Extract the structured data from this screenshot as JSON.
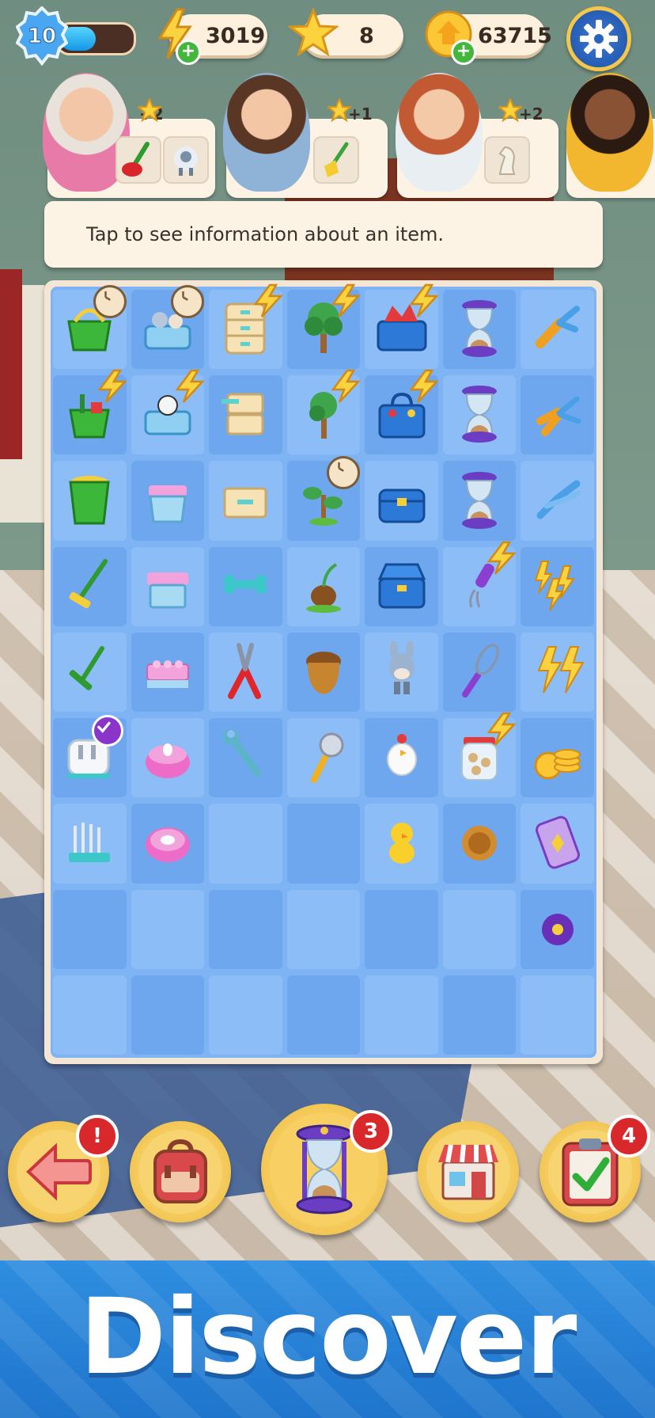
{
  "hud": {
    "level": "10",
    "xp_progress_fraction": 0.5,
    "energy": "3019",
    "stars": "8",
    "coins": "63715",
    "energy_icon": "lightning-bolt-icon",
    "star_icon": "star-icon",
    "coin_icon": "coin-icon",
    "settings_icon": "gear-icon"
  },
  "characters": [
    {
      "name_icon": "grandma-avatar",
      "reward": "+2",
      "items": [
        "plunger-icon",
        "sheep-toy-icon"
      ]
    },
    {
      "name_icon": "woman-overalls-avatar",
      "reward": "+1",
      "items": [
        "broom-icon"
      ]
    },
    {
      "name_icon": "redhead-woman-avatar",
      "reward": "+2",
      "items": [
        "chess-knight-icon"
      ]
    },
    {
      "name_icon": "woman-yellow-shirt-avatar",
      "reward": "",
      "items": []
    }
  ],
  "info_text": "Tap to see information about an item.",
  "board": {
    "columns": 7,
    "rows": 9,
    "items": [
      {
        "row": 0,
        "col": 0,
        "icon": "basket-icon",
        "badge": "clock"
      },
      {
        "row": 0,
        "col": 1,
        "icon": "toy-box-animals-icon",
        "badge": "clock"
      },
      {
        "row": 0,
        "col": 2,
        "icon": "drawer-cabinet-icon",
        "badge": "bolt"
      },
      {
        "row": 0,
        "col": 3,
        "icon": "tree-icon",
        "badge": "bolt"
      },
      {
        "row": 0,
        "col": 4,
        "icon": "toolbox-open-icon",
        "badge": "bolt"
      },
      {
        "row": 0,
        "col": 5,
        "icon": "hourglass-icon",
        "badge": ""
      },
      {
        "row": 0,
        "col": 6,
        "icon": "pliers-icon",
        "badge": ""
      },
      {
        "row": 1,
        "col": 0,
        "icon": "cleaning-bucket-icon",
        "badge": "bolt"
      },
      {
        "row": 1,
        "col": 1,
        "icon": "toy-box-cow-icon",
        "badge": "bolt"
      },
      {
        "row": 1,
        "col": 2,
        "icon": "drawers-icon",
        "badge": ""
      },
      {
        "row": 1,
        "col": 3,
        "icon": "young-tree-icon",
        "badge": "bolt"
      },
      {
        "row": 1,
        "col": 4,
        "icon": "toolbox-tools-icon",
        "badge": "bolt"
      },
      {
        "row": 1,
        "col": 5,
        "icon": "hourglass-icon",
        "badge": ""
      },
      {
        "row": 1,
        "col": 6,
        "icon": "wire-cutter-icon",
        "badge": ""
      },
      {
        "row": 2,
        "col": 0,
        "icon": "green-bucket-icon",
        "badge": ""
      },
      {
        "row": 2,
        "col": 1,
        "icon": "plastic-bin-icon",
        "badge": ""
      },
      {
        "row": 2,
        "col": 2,
        "icon": "drawer-icon",
        "badge": ""
      },
      {
        "row": 2,
        "col": 3,
        "icon": "sapling-icon",
        "badge": "clock"
      },
      {
        "row": 2,
        "col": 4,
        "icon": "toolbox-closed-icon",
        "badge": ""
      },
      {
        "row": 2,
        "col": 5,
        "icon": "hourglass-icon",
        "badge": ""
      },
      {
        "row": 2,
        "col": 6,
        "icon": "pliers-blue-icon",
        "badge": ""
      },
      {
        "row": 3,
        "col": 0,
        "icon": "mop-icon",
        "badge": ""
      },
      {
        "row": 3,
        "col": 1,
        "icon": "storage-box-icon",
        "badge": ""
      },
      {
        "row": 3,
        "col": 2,
        "icon": "bone-handle-icon",
        "badge": ""
      },
      {
        "row": 3,
        "col": 3,
        "icon": "sprout-seed-icon",
        "badge": ""
      },
      {
        "row": 3,
        "col": 4,
        "icon": "toolbox-blue-icon",
        "badge": ""
      },
      {
        "row": 3,
        "col": 5,
        "icon": "hand-mixer-icon",
        "badge": "bolt"
      },
      {
        "row": 3,
        "col": 6,
        "icon": "triple-bolt-icon",
        "badge": ""
      },
      {
        "row": 4,
        "col": 0,
        "icon": "squeegee-icon",
        "badge": ""
      },
      {
        "row": 4,
        "col": 1,
        "icon": "pink-lego-icon",
        "badge": ""
      },
      {
        "row": 4,
        "col": 2,
        "icon": "red-pliers-icon",
        "badge": ""
      },
      {
        "row": 4,
        "col": 3,
        "icon": "acorn-icon",
        "badge": ""
      },
      {
        "row": 4,
        "col": 4,
        "icon": "donkey-toy-icon",
        "badge": ""
      },
      {
        "row": 4,
        "col": 5,
        "icon": "whisk-icon",
        "badge": ""
      },
      {
        "row": 4,
        "col": 6,
        "icon": "double-bolt-icon",
        "badge": ""
      },
      {
        "row": 5,
        "col": 0,
        "icon": "toaster-icon",
        "badge": "check"
      },
      {
        "row": 5,
        "col": 1,
        "icon": "pink-candle-icon",
        "badge": ""
      },
      {
        "row": 5,
        "col": 2,
        "icon": "wrench-icon",
        "badge": ""
      },
      {
        "row": 5,
        "col": 3,
        "icon": "pizza-cutter-icon",
        "badge": ""
      },
      {
        "row": 5,
        "col": 4,
        "icon": "chicken-toy-icon",
        "badge": ""
      },
      {
        "row": 5,
        "col": 5,
        "icon": "cookie-jar-icon",
        "badge": "bolt"
      },
      {
        "row": 5,
        "col": 6,
        "icon": "coin-stack-icon",
        "badge": ""
      },
      {
        "row": 6,
        "col": 0,
        "icon": "dish-rack-icon",
        "badge": ""
      },
      {
        "row": 6,
        "col": 1,
        "icon": "pink-ring-icon",
        "badge": ""
      },
      {
        "row": 6,
        "col": 4,
        "icon": "chick-toy-icon",
        "badge": ""
      },
      {
        "row": 6,
        "col": 5,
        "icon": "cookie-icon",
        "badge": ""
      },
      {
        "row": 6,
        "col": 6,
        "icon": "purple-capsule-icon",
        "badge": ""
      },
      {
        "row": 7,
        "col": 6,
        "icon": "purple-orb-icon",
        "badge": ""
      }
    ]
  },
  "bottom_bar": [
    {
      "name": "back-button",
      "icon": "back-arrow-icon",
      "badge": "!"
    },
    {
      "name": "bag-button",
      "icon": "backpack-icon",
      "badge": ""
    },
    {
      "name": "hourglass-generator-button",
      "icon": "hourglass-icon",
      "badge": "3"
    },
    {
      "name": "shop-button",
      "icon": "shop-icon",
      "badge": ""
    },
    {
      "name": "tasks-button",
      "icon": "clipboard-check-icon",
      "badge": "4"
    }
  ],
  "banner_text": "Discover",
  "colors": {
    "board_blue": "#7fb4f4",
    "gold": "#f0b935",
    "badge_red": "#d9282c",
    "banner_blue": "#1f75cc"
  }
}
